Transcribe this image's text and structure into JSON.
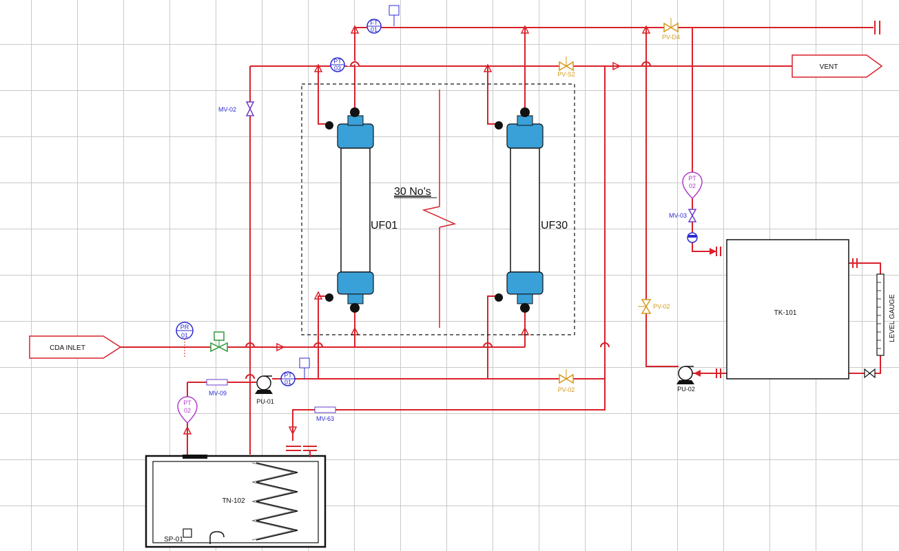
{
  "equipment": {
    "cda_inlet": "CDA INLET",
    "vent": "VENT",
    "tk101": "TK-101",
    "tn102": "TN-102",
    "level_gauge": "LEVEL GAUGE",
    "uf01": "UF01",
    "uf30": "UF30",
    "count_note": "30 No's",
    "sp01": "SP-01"
  },
  "instruments": {
    "pr01": [
      "PR",
      "01"
    ],
    "pt01": [
      "PT",
      "01"
    ],
    "pt03": [
      "PT",
      "03"
    ],
    "ft01": [
      "FT",
      "01"
    ],
    "pt02": [
      "PT",
      "02"
    ],
    "pt02b": [
      "PT",
      "02"
    ]
  },
  "valves": {
    "mv02": "MV-02",
    "mv03": "MV-03",
    "mv09": "MV-09",
    "mv63": "MV-63",
    "pv02_right": "PV-02",
    "pv02_bottom": "PV-02",
    "pvs2": "PV-S2",
    "pvd4": "PV-D4"
  },
  "pumps": {
    "pu01": "PU-01",
    "pu02": "PU-02"
  },
  "colors": {
    "pipe": "#d8202a",
    "instrument_blue": "#2b2bd0",
    "valve_orange": "#d49a1a",
    "purple": "#b03cc8",
    "membrane_blue": "#3aa0d8",
    "solenoid_green": "#2e9a3a"
  }
}
